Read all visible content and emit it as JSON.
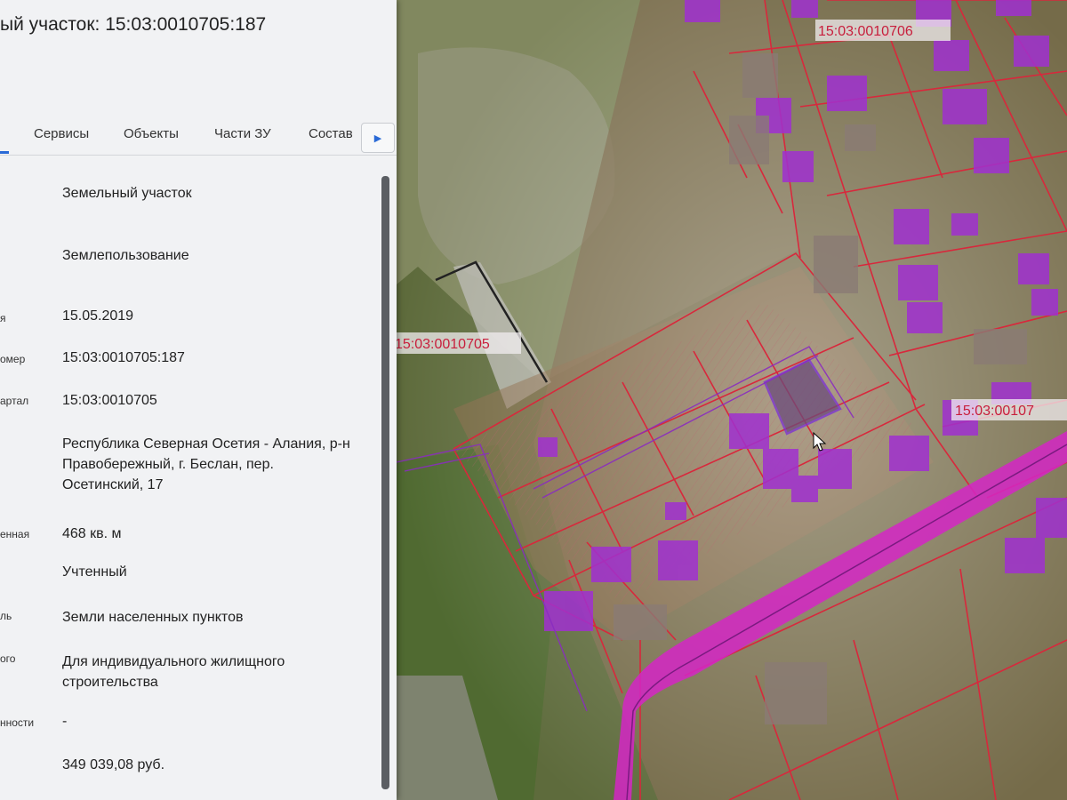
{
  "panel": {
    "title": "ый участок: 15:03:0010705:187",
    "tabs": [
      {
        "label": "Сервисы"
      },
      {
        "label": "Объекты"
      },
      {
        "label": "Части ЗУ"
      },
      {
        "label": "Состав"
      }
    ],
    "tabs_next_icon": "chevron-right-icon",
    "fields": [
      {
        "label": "",
        "value": "Земельный участок"
      },
      {
        "label": "",
        "value": "Землепользование"
      },
      {
        "label": "я",
        "value": "15.05.2019"
      },
      {
        "label": "омер",
        "value": "15:03:0010705:187"
      },
      {
        "label": "артал",
        "value": "15:03:0010705"
      },
      {
        "label": "",
        "value": "Республика Северная Осетия - Алания, р-н Правобережный, г. Беслан, пер. Осетинский, 17"
      },
      {
        "label": "енная",
        "value": "468 кв. м"
      },
      {
        "label": "",
        "value": "Учтенный"
      },
      {
        "label": "ль",
        "value": "Земли населенных пунктов"
      },
      {
        "label": "ого",
        "value": "Для индивидуального жилищного строительства"
      },
      {
        "label": "нности",
        "value": "-"
      },
      {
        "label": "",
        "value": "349 039,08 руб."
      }
    ]
  },
  "map": {
    "labels": [
      {
        "text": "15:03:0010706"
      },
      {
        "text": "15:03:0010705"
      },
      {
        "text": "15:03:00107"
      }
    ],
    "colors": {
      "parcel_border": "#d8283c",
      "building_fill": "#a030d0",
      "road_fill": "#d526c6",
      "selected_border": "#7a2fd6"
    }
  }
}
